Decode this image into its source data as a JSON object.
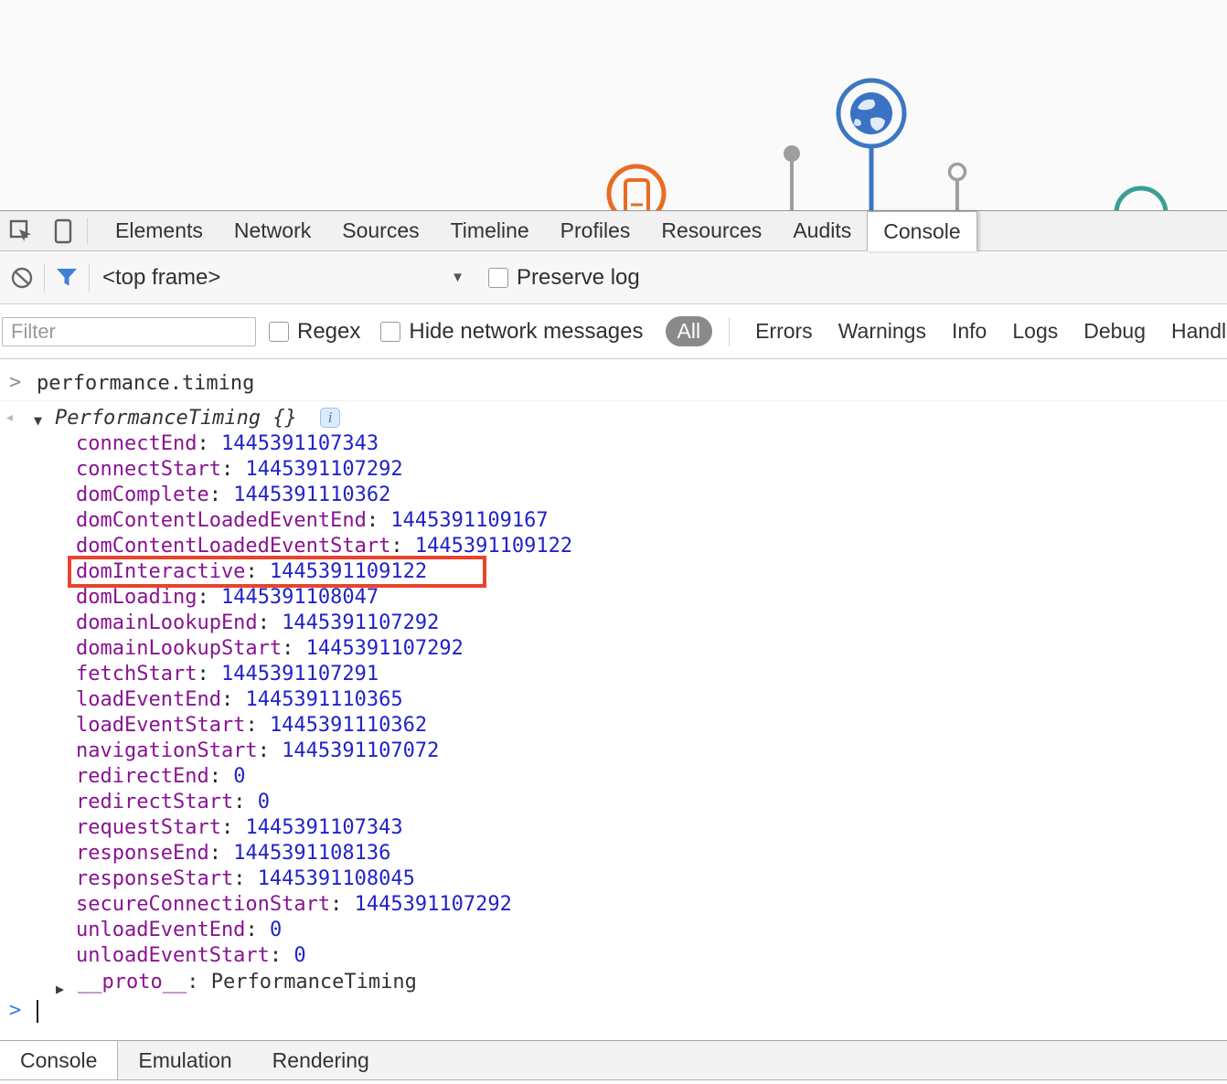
{
  "page_top": {
    "icons": [
      "browser-globe-icon",
      "device-icon",
      "map-pin-icon",
      "map-pin-icon-2",
      "teal-circle-icon"
    ],
    "colors": {
      "globe": "#3b78c2",
      "device_orange": "#e96c24",
      "pin_gray": "#9e9e9e",
      "teal": "#379f98",
      "background": "#fafafa"
    }
  },
  "devtools": {
    "tabs": [
      {
        "label": "Elements",
        "active": false
      },
      {
        "label": "Network",
        "active": false
      },
      {
        "label": "Sources",
        "active": false
      },
      {
        "label": "Timeline",
        "active": false
      },
      {
        "label": "Profiles",
        "active": false
      },
      {
        "label": "Resources",
        "active": false
      },
      {
        "label": "Audits",
        "active": false
      },
      {
        "label": "Console",
        "active": true
      }
    ],
    "console_toolbar": {
      "frame_selector": "<top frame>",
      "preserve_log_label": "Preserve log"
    },
    "filter_bar": {
      "placeholder": "Filter",
      "regex_label": "Regex",
      "hide_network_label": "Hide network messages",
      "levels": [
        {
          "label": "All",
          "active": true
        },
        {
          "label": "Errors",
          "active": false
        },
        {
          "label": "Warnings",
          "active": false
        },
        {
          "label": "Info",
          "active": false
        },
        {
          "label": "Logs",
          "active": false
        },
        {
          "label": "Debug",
          "active": false
        },
        {
          "label": "Handled",
          "active": false
        }
      ]
    },
    "console": {
      "input_echo": "performance.timing",
      "result_object": "PerformanceTiming",
      "result_braces": "{}",
      "properties": [
        {
          "name": "connectEnd",
          "value": "1445391107343"
        },
        {
          "name": "connectStart",
          "value": "1445391107292"
        },
        {
          "name": "domComplete",
          "value": "1445391110362"
        },
        {
          "name": "domContentLoadedEventEnd",
          "value": "1445391109167"
        },
        {
          "name": "domContentLoadedEventStart",
          "value": "1445391109122"
        },
        {
          "name": "domInteractive",
          "value": "1445391109122",
          "highlighted": true
        },
        {
          "name": "domLoading",
          "value": "1445391108047"
        },
        {
          "name": "domainLookupEnd",
          "value": "1445391107292"
        },
        {
          "name": "domainLookupStart",
          "value": "1445391107292"
        },
        {
          "name": "fetchStart",
          "value": "1445391107291"
        },
        {
          "name": "loadEventEnd",
          "value": "1445391110365"
        },
        {
          "name": "loadEventStart",
          "value": "1445391110362"
        },
        {
          "name": "navigationStart",
          "value": "1445391107072"
        },
        {
          "name": "redirectEnd",
          "value": "0"
        },
        {
          "name": "redirectStart",
          "value": "0"
        },
        {
          "name": "requestStart",
          "value": "1445391107343"
        },
        {
          "name": "responseEnd",
          "value": "1445391108136"
        },
        {
          "name": "responseStart",
          "value": "1445391108045"
        },
        {
          "name": "secureConnectionStart",
          "value": "1445391107292"
        },
        {
          "name": "unloadEventEnd",
          "value": "0"
        },
        {
          "name": "unloadEventStart",
          "value": "0"
        }
      ],
      "proto": {
        "name": "__proto__",
        "value": "PerformanceTiming"
      }
    },
    "drawer_tabs": [
      {
        "label": "Console",
        "active": true
      },
      {
        "label": "Emulation",
        "active": false
      },
      {
        "label": "Rendering",
        "active": false
      }
    ],
    "highlight_color": "#e8442c",
    "property_name_color": "#881391",
    "value_color": "#2023c7"
  }
}
